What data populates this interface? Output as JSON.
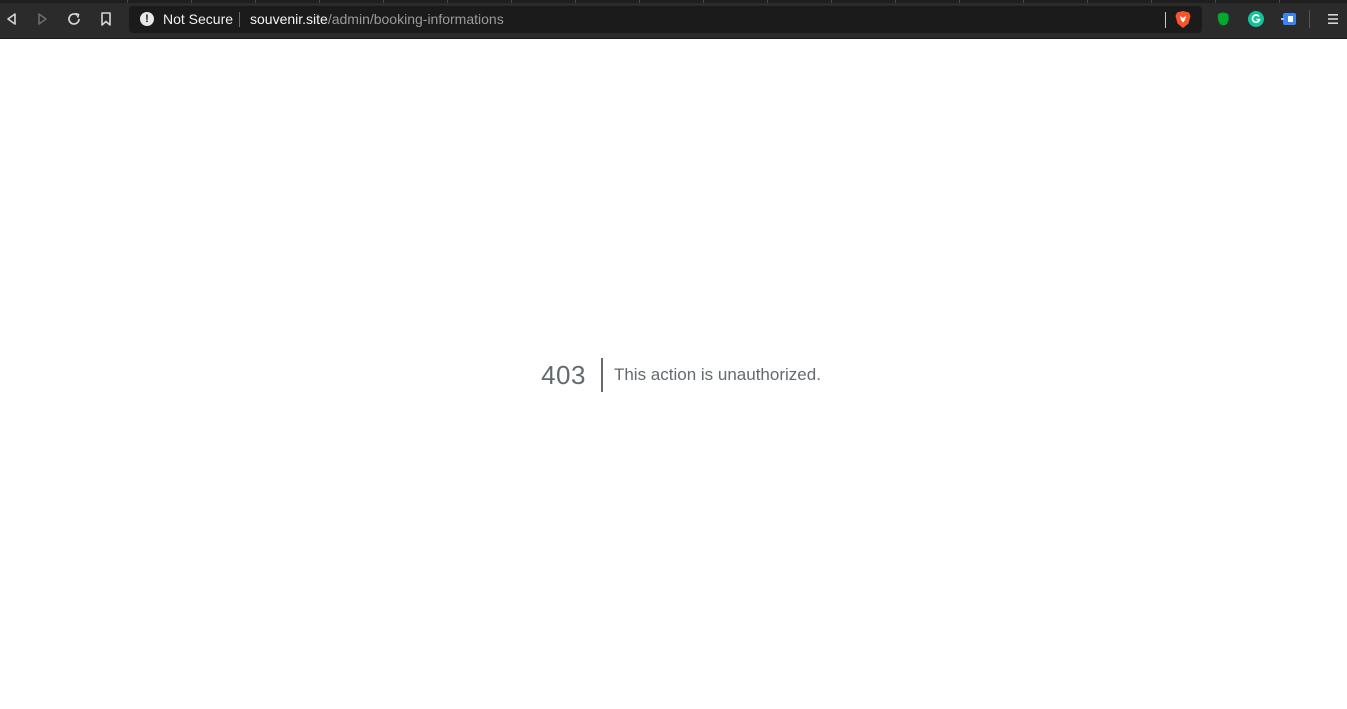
{
  "browser": {
    "security_label": "Not Secure",
    "url_host": "souvenir.site",
    "url_path": "/admin/booking-informations",
    "icons": {
      "back": "back-arrow-icon",
      "forward": "forward-arrow-icon",
      "reload": "reload-icon",
      "bookmark": "bookmark-icon",
      "security": "warning-icon",
      "brave": "brave-shield-icon",
      "extensions": [
        "evernote-icon",
        "grammarly-icon",
        "extension-icon"
      ],
      "menu": "hamburger-menu-icon"
    },
    "colors": {
      "toolbar": "#2b2b2b",
      "address_bar": "#1b1b1b",
      "brave": "#fb542b",
      "evernote": "#00a82d",
      "grammarly": "#15c39a",
      "extension": "#3b82f6"
    }
  },
  "page": {
    "error_code": "403",
    "error_message": "This action is unauthorized.",
    "text_color": "#636b6f"
  }
}
